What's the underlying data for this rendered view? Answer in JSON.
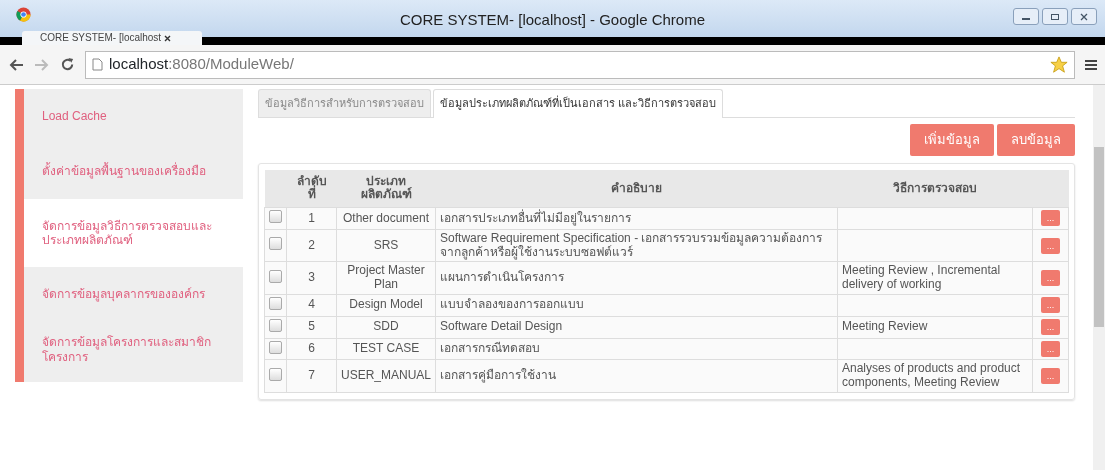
{
  "window": {
    "title": "CORE SYSTEM- [localhost] - Google Chrome"
  },
  "browser_tab": {
    "label": "CORE SYSTEM- [localhost"
  },
  "address_bar": {
    "host": "localhost",
    "rest": ":8080/ModuleWeb/"
  },
  "sidebar": {
    "items": [
      {
        "label": "Load Cache",
        "selected": false
      },
      {
        "label": "ตั้งค่าข้อมูลพื้นฐานของเครื่องมือ",
        "selected": false
      },
      {
        "label": "จัดการข้อมูลวิธีการตรวจสอบและประเภทผลิตภัณฑ์",
        "selected": true
      },
      {
        "label": "จัดการข้อมูลบุคลากรขององค์กร",
        "selected": false
      },
      {
        "label": "จัดการข้อมูลโครงการและสมาชิกโครงการ",
        "selected": false
      }
    ]
  },
  "tabs": [
    {
      "label": "ข้อมูลวิธีการสำหรับการตรวจสอบ",
      "selected": false
    },
    {
      "label": "ข้อมูลประเภทผลิตภัณฑ์ที่เป็นเอกสาร และวิธีการตรวจสอบ",
      "selected": true
    }
  ],
  "buttons": [
    "เพิ่มข้อมูล",
    "ลบข้อมูล"
  ],
  "table": {
    "columns": [
      "ลำดับที่",
      "ประเภทผลิตภัณฑ์",
      "คำอธิบาย",
      "วิธีการตรวจสอบ"
    ],
    "rows": [
      {
        "checked": false,
        "no": "1",
        "type": "Other document",
        "description": "เอกสารประเภทอื่นที่ไม่มีอยู่ในรายการ",
        "method": "",
        "action": "..."
      },
      {
        "checked": false,
        "no": "2",
        "type": "SRS",
        "description": "Software Requirement Specification - เอกสารรวบรวมข้อมูลความต้องการจากลูกค้าหรือผู้ใช้งานระบบซอฟต์แวร์",
        "method": "",
        "action": "..."
      },
      {
        "checked": false,
        "no": "3",
        "type": "Project Master Plan",
        "description": "แผนการดำเนินโครงการ",
        "method": "Meeting Review , Incremental delivery of working",
        "action": "..."
      },
      {
        "checked": false,
        "no": "4",
        "type": "Design Model",
        "description": "แบบจำลองของการออกแบบ",
        "method": "",
        "action": "..."
      },
      {
        "checked": false,
        "no": "5",
        "type": "SDD",
        "description": "Software Detail Design",
        "method": "Meeting Review",
        "action": "..."
      },
      {
        "checked": false,
        "no": "6",
        "type": "TEST CASE",
        "description": "เอกสารกรณีทดสอบ",
        "method": "",
        "action": "..."
      },
      {
        "checked": false,
        "no": "7",
        "type": "USER_MANUAL",
        "description": "เอกสารคู่มือการใช้งาน",
        "method": "Analyses of products and product components, Meeting Review",
        "action": "..."
      }
    ]
  }
}
